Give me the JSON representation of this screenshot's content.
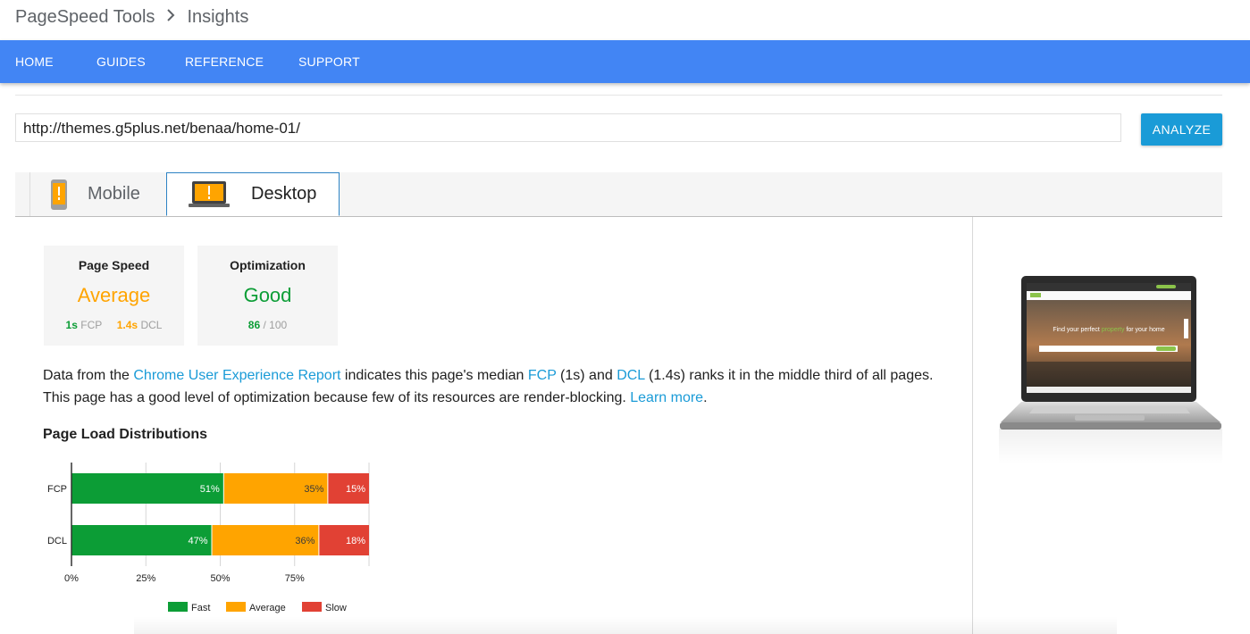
{
  "breadcrumb": {
    "root": "PageSpeed Tools",
    "current": "Insights"
  },
  "nav": [
    "HOME",
    "GUIDES",
    "REFERENCE",
    "SUPPORT"
  ],
  "url_input": {
    "value": "http://themes.g5plus.net/benaa/home-01/"
  },
  "analyze_label": "ANALYZE",
  "tabs": {
    "mobile": "Mobile",
    "desktop": "Desktop",
    "selected": "Desktop"
  },
  "cards": {
    "page_speed": {
      "title": "Page Speed",
      "rating": "Average",
      "fcp_value": "1s",
      "fcp_label": "FCP",
      "dcl_value": "1.4s",
      "dcl_label": "DCL"
    },
    "optimization": {
      "title": "Optimization",
      "rating": "Good",
      "score": "86",
      "score_suffix": "/ 100"
    }
  },
  "description": {
    "p1": "Data from the ",
    "link1": "Chrome User Experience Report",
    "p2": " indicates this page's median ",
    "link2": "FCP",
    "p3": " (1s) and ",
    "link3": "DCL",
    "p4": " (1.4s) ranks it in the middle third of all pages. This page has a good level of optimization because few of its resources are render-blocking. ",
    "link4": "Learn more",
    "p5": "."
  },
  "section_title": "Page Load Distributions",
  "colors": {
    "fast": "#0c9d36",
    "average": "#ffa400",
    "slow": "#e14134",
    "accent": "#1a9bd7",
    "nav": "#4285f4"
  },
  "preview": {
    "hero_text_1": "Find your perfect ",
    "hero_text_accent": "property",
    "hero_text_2": " for your home"
  },
  "chart_data": {
    "type": "bar",
    "stacked": true,
    "orientation": "horizontal",
    "categories": [
      "FCP",
      "DCL"
    ],
    "series": [
      {
        "name": "Fast",
        "values": [
          51,
          47
        ],
        "labels": [
          "51%",
          "47%"
        ]
      },
      {
        "name": "Average",
        "values": [
          35,
          36
        ],
        "labels": [
          "35%",
          "36%"
        ]
      },
      {
        "name": "Slow",
        "values": [
          15,
          18
        ],
        "labels": [
          "15%",
          "18%"
        ]
      }
    ],
    "xticks": [
      "0%",
      "25%",
      "50%",
      "75%"
    ],
    "xlim": [
      0,
      100
    ],
    "legend": "bottom",
    "grid": true
  }
}
